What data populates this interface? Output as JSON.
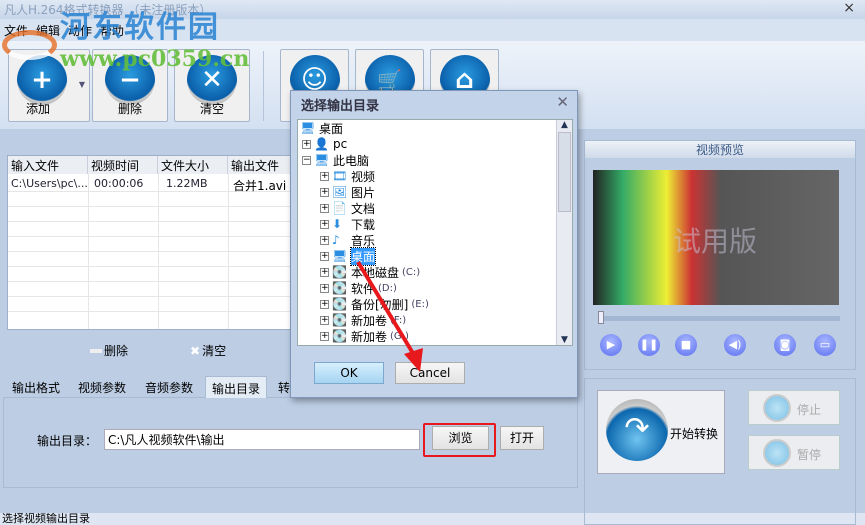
{
  "window": {
    "title": "凡人H.264格式转换器  （未注册版本）",
    "close": "×"
  },
  "watermark": {
    "site_name": "河东软件园",
    "url": "www.pc0359.cn"
  },
  "menu": [
    "文件",
    "编辑",
    "动作",
    "帮助"
  ],
  "toolbar": {
    "add": "添加",
    "delete": "删除",
    "clear": "清空"
  },
  "file_list": {
    "columns": [
      "输入文件",
      "视频时间",
      "文件大小",
      "输出文件"
    ],
    "rows": [
      [
        "C:\\Users\\pc\\...",
        "00:00:06",
        "1.22MB",
        "合并1.avi"
      ]
    ],
    "delete": "删除",
    "clear": "清空"
  },
  "tabs": [
    "输出格式",
    "视频参数",
    "音频参数",
    "输出目录",
    "转"
  ],
  "output": {
    "label": "输出目录：",
    "path": "C:\\凡人视频软件\\输出",
    "browse": "浏览",
    "open": "打开"
  },
  "preview": {
    "title": "视频预览",
    "watermark": "试用版",
    "progress": 0
  },
  "actions": {
    "start": "开始转换",
    "stop": "停止",
    "pause": "暂停"
  },
  "status": "选择视频输出目录",
  "dialog": {
    "title": "选择输出目录",
    "close": "✕",
    "tree": [
      {
        "label": "桌面",
        "level": 0
      },
      {
        "label": "pc",
        "level": 1
      },
      {
        "label": "此电脑",
        "level": 1
      },
      {
        "label": "视频",
        "level": 2
      },
      {
        "label": "图片",
        "level": 2
      },
      {
        "label": "文档",
        "level": 2
      },
      {
        "label": "下载",
        "level": 2
      },
      {
        "label": "音乐",
        "level": 2
      },
      {
        "label": "桌面",
        "level": 2,
        "selected": true
      },
      {
        "label": "本地磁盘",
        "drive": "(C:)",
        "level": 2
      },
      {
        "label": "软件",
        "drive": "(D:)",
        "level": 2
      },
      {
        "label": "备份[勿删]",
        "drive": "(E:)",
        "level": 2
      },
      {
        "label": "新加卷",
        "drive": "(F:)",
        "level": 2
      },
      {
        "label": "新加卷",
        "drive": "(G:)",
        "level": 2
      }
    ],
    "ok": "OK",
    "cancel": "Cancel"
  }
}
